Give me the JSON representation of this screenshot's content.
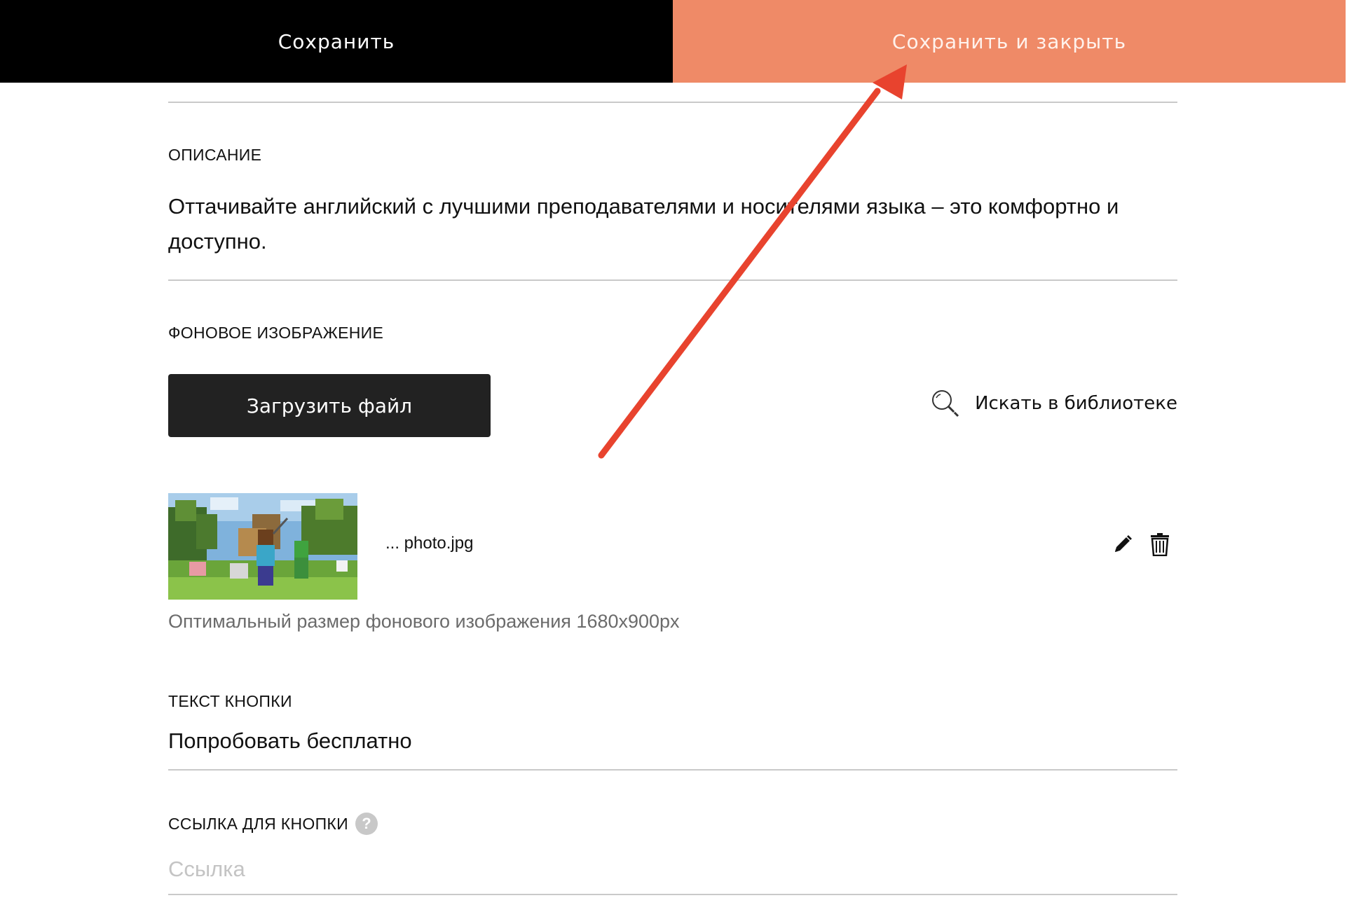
{
  "toolbar": {
    "save_label": "Сохранить",
    "save_close_label": "Сохранить и закрыть",
    "save_color": "#000000",
    "save_close_color": "#ef8a67"
  },
  "description": {
    "label": "ОПИСАНИЕ",
    "text": "Оттачивайте английский с лучшими преподавателями и носителями языка – это комфортно и доступно."
  },
  "background_image": {
    "label": "ФОНОВОЕ ИЗОБРАЖЕНИЕ",
    "upload_label": "Загрузить файл",
    "library_label": "Искать в библиотеке",
    "file_name": "... photo.jpg",
    "hint": "Оптимальный размер фонового изображения 1680x900px",
    "icons": [
      "search-icon",
      "pencil-icon",
      "trash-icon"
    ]
  },
  "button_text": {
    "label": "ТЕКСТ КНОПКИ",
    "value": "Попробовать бесплатно"
  },
  "button_link": {
    "label": "ССЫЛКА ДЛЯ КНОПКИ",
    "help_symbol": "?",
    "placeholder": "Ссылка",
    "value": ""
  },
  "colors": {
    "annotation_arrow": "#e8432e",
    "divider": "#c9c9c9"
  }
}
